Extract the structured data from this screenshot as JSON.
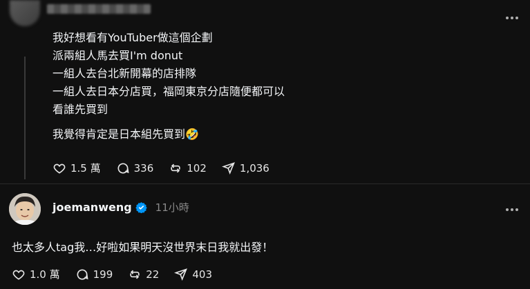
{
  "post1": {
    "lines": [
      "我好想看有YouTuber做這個企劃",
      "派兩組人馬去買I'm donut",
      "一組人去台北新開幕的店排隊",
      "一組人去日本分店買，福岡東京分店隨便都可以",
      "看誰先買到",
      "我覺得肯定是日本組先買到🤣"
    ],
    "likes": "1.5 萬",
    "comments": "336",
    "reposts": "102",
    "shares": "1,036"
  },
  "post2": {
    "author": "joemanweng",
    "time": "11小時",
    "text": "也太多人tag我…好啦如果明天沒世界末日我就出發！",
    "likes": "1.0 萬",
    "comments": "199",
    "reposts": "22",
    "shares": "403"
  },
  "colors": {
    "background": "#101010",
    "verified": "#0095f6",
    "text": "#f3f5f7",
    "muted": "#8a8a8a"
  },
  "icons": [
    "heart-icon",
    "comment-icon",
    "repost-icon",
    "share-icon",
    "more-icon",
    "verified-icon"
  ]
}
